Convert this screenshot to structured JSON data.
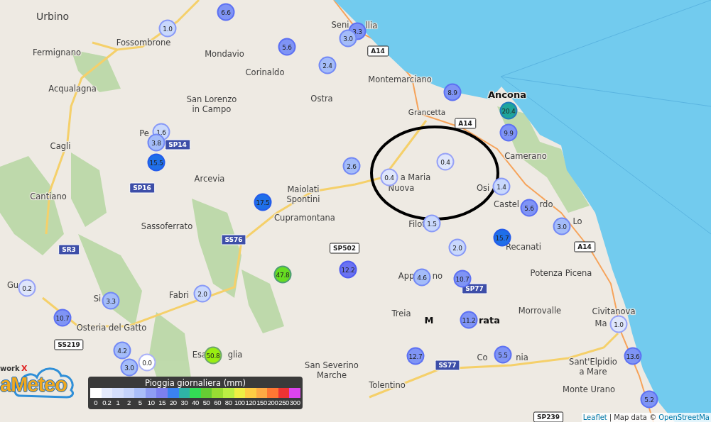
{
  "map": {
    "places": [
      {
        "name": "Urbino",
        "kind": "large"
      },
      {
        "name": "Fossombrone",
        "kind": "town"
      },
      {
        "name": "Fermignano",
        "kind": "town"
      },
      {
        "name": "Mondavio",
        "kind": "town"
      },
      {
        "name": "Corinaldo",
        "kind": "town"
      },
      {
        "name": "Seni",
        "kind": "town"
      },
      {
        "name": "llia",
        "kind": "town"
      },
      {
        "name": "Acqualagna",
        "kind": "town"
      },
      {
        "name": "Montemarciano",
        "kind": "town"
      },
      {
        "name": "San Lorenzo\nin Campo",
        "kind": "town"
      },
      {
        "name": "Ostra",
        "kind": "town"
      },
      {
        "name": "Ancona",
        "kind": "city"
      },
      {
        "name": "Grancetta",
        "kind": "small"
      },
      {
        "name": "Pe",
        "kind": "town"
      },
      {
        "name": "Cagli",
        "kind": "town"
      },
      {
        "name": "Camerano",
        "kind": "town"
      },
      {
        "name": "Arcevia",
        "kind": "town"
      },
      {
        "name": "a Maria",
        "kind": "town"
      },
      {
        "name": "Nuova",
        "kind": "town"
      },
      {
        "name": "Osi",
        "kind": "town"
      },
      {
        "name": "Cantiano",
        "kind": "town"
      },
      {
        "name": "Maiolati\nSpontini",
        "kind": "town"
      },
      {
        "name": "Castel",
        "kind": "town"
      },
      {
        "name": "rdo",
        "kind": "town"
      },
      {
        "name": "Cupramontana",
        "kind": "town"
      },
      {
        "name": "Filot",
        "kind": "town"
      },
      {
        "name": "Lo",
        "kind": "town"
      },
      {
        "name": "Sassoferrato",
        "kind": "town"
      },
      {
        "name": "Recanati",
        "kind": "town"
      },
      {
        "name": "Potenza Picena",
        "kind": "town"
      },
      {
        "name": "Gu",
        "kind": "town"
      },
      {
        "name": "App",
        "kind": "town"
      },
      {
        "name": "no",
        "kind": "town"
      },
      {
        "name": "Fabri",
        "kind": "town"
      },
      {
        "name": "Si",
        "kind": "town"
      },
      {
        "name": "Morrovalle",
        "kind": "town"
      },
      {
        "name": "Treia",
        "kind": "town"
      },
      {
        "name": "Civitanova",
        "kind": "town"
      },
      {
        "name": "Osteria del Gatto",
        "kind": "town"
      },
      {
        "name": "M",
        "kind": "city"
      },
      {
        "name": "rata",
        "kind": "city"
      },
      {
        "name": "Ma",
        "kind": "town"
      },
      {
        "name": "Esa",
        "kind": "town"
      },
      {
        "name": "glia",
        "kind": "town"
      },
      {
        "name": "Co",
        "kind": "town"
      },
      {
        "name": "nia",
        "kind": "town"
      },
      {
        "name": "San Severino\nMarche",
        "kind": "town"
      },
      {
        "name": "Sant'Elpidio\na Mare",
        "kind": "town"
      },
      {
        "name": "Monte Urano",
        "kind": "town"
      },
      {
        "name": "Tolentino",
        "kind": "town"
      }
    ],
    "road_shields": [
      {
        "label": "A14",
        "kind": "outlined"
      },
      {
        "label": "A14",
        "kind": "outlined"
      },
      {
        "label": "A14",
        "kind": "outlined"
      },
      {
        "label": "SP14",
        "kind": "filled"
      },
      {
        "label": "SP16",
        "kind": "filled"
      },
      {
        "label": "SS76",
        "kind": "filled"
      },
      {
        "label": "SR3",
        "kind": "filled"
      },
      {
        "label": "SP502",
        "kind": "outlined"
      },
      {
        "label": "SP77",
        "kind": "filled"
      },
      {
        "label": "SS77",
        "kind": "filled"
      },
      {
        "label": "SS219",
        "kind": "outlined"
      },
      {
        "label": "SP239",
        "kind": "outlined"
      }
    ],
    "stations": [
      {
        "value": "1.0",
        "color": "#c9d8fc"
      },
      {
        "value": "6.6",
        "color": "#7f94f5"
      },
      {
        "value": "5.6",
        "color": "#7f94f5"
      },
      {
        "value": "2.4",
        "color": "#a4bcf9"
      },
      {
        "value": "3.3",
        "color": "#7f94f5"
      },
      {
        "value": "3.0",
        "color": "#a4bcf9"
      },
      {
        "value": "8.9",
        "color": "#7f94f5"
      },
      {
        "value": "20.4",
        "color": "#1ea59b"
      },
      {
        "value": "9.9",
        "color": "#7f94f5"
      },
      {
        "value": "1.6",
        "color": "#c9d8fc"
      },
      {
        "value": "3.8",
        "color": "#a4bcf9"
      },
      {
        "value": "15.5",
        "color": "#1f6fe8"
      },
      {
        "value": "2.6",
        "color": "#a4bcf9"
      },
      {
        "value": "0.4",
        "color": "#dfe6fb"
      },
      {
        "value": "0.4",
        "color": "#dfe6fb"
      },
      {
        "value": "1.4",
        "color": "#c9d8fc"
      },
      {
        "value": "17.5",
        "color": "#1f6fe8"
      },
      {
        "value": "5.6",
        "color": "#7f94f5"
      },
      {
        "value": "3.0",
        "color": "#a4bcf9"
      },
      {
        "value": "1.5",
        "color": "#c9d8fc"
      },
      {
        "value": "15.7",
        "color": "#1f6fe8"
      },
      {
        "value": "2.0",
        "color": "#c9d8fc"
      },
      {
        "value": "47.8",
        "color": "#66dd22"
      },
      {
        "value": "12.2",
        "color": "#6a72f2"
      },
      {
        "value": "4.6",
        "color": "#a4bcf9"
      },
      {
        "value": "10.7",
        "color": "#7f94f5"
      },
      {
        "value": "0.2",
        "color": "#dfe6fb"
      },
      {
        "value": "2.0",
        "color": "#c9d8fc"
      },
      {
        "value": "3.3",
        "color": "#a4bcf9"
      },
      {
        "value": "10.7",
        "color": "#7f94f5"
      },
      {
        "value": "11.2",
        "color": "#7f94f5"
      },
      {
        "value": "1.0",
        "color": "#dfe6fb"
      },
      {
        "value": "4.2",
        "color": "#a4bcf9"
      },
      {
        "value": "0.0",
        "color": "#ffffff"
      },
      {
        "value": "3.0",
        "color": "#a4bcf9"
      },
      {
        "value": "50.8",
        "color": "#99ee11"
      },
      {
        "value": "12.7",
        "color": "#7f94f5"
      },
      {
        "value": "5.5",
        "color": "#7f94f5"
      },
      {
        "value": "13.6",
        "color": "#7f94f5"
      },
      {
        "value": "5.2",
        "color": "#7f94f5"
      }
    ]
  },
  "legend": {
    "title": "Pioggia giornaliera (mm)",
    "steps": [
      {
        "label": "0",
        "color": "#ffffff"
      },
      {
        "label": "0.2",
        "color": "#e4eafc"
      },
      {
        "label": "1",
        "color": "#d4defb"
      },
      {
        "label": "2",
        "color": "#c4d2fa"
      },
      {
        "label": "5",
        "color": "#aabef8"
      },
      {
        "label": "10",
        "color": "#8f9df3"
      },
      {
        "label": "15",
        "color": "#7c80ef"
      },
      {
        "label": "20",
        "color": "#3b82f0"
      },
      {
        "label": "30",
        "color": "#2fb3a6"
      },
      {
        "label": "40",
        "color": "#33dd55"
      },
      {
        "label": "50",
        "color": "#66cc33"
      },
      {
        "label": "60",
        "color": "#99dd33"
      },
      {
        "label": "80",
        "color": "#bbee44"
      },
      {
        "label": "100",
        "color": "#eeee44"
      },
      {
        "label": "120",
        "color": "#ffcc44"
      },
      {
        "label": "150",
        "color": "#ffaa44"
      },
      {
        "label": "200",
        "color": "#ff7733"
      },
      {
        "label": "250",
        "color": "#ee3333"
      },
      {
        "label": "300",
        "color": "#dd44ee"
      }
    ]
  },
  "logo": {
    "prefix": "work",
    "mark": "X",
    "name": "aMeteo"
  },
  "attribution": {
    "link": "Leaflet",
    "separator": "|",
    "text": "Map data ©",
    "source": "OpenStreetMa"
  }
}
